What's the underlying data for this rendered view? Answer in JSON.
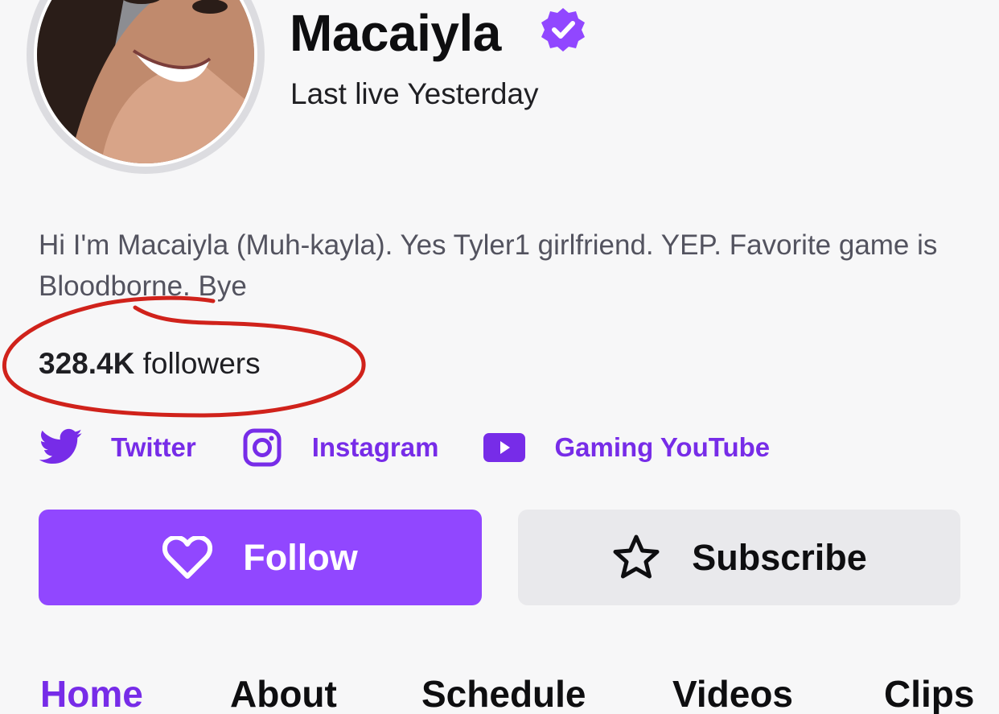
{
  "profile": {
    "display_name": "Macaiyla",
    "last_live": "Last live Yesterday",
    "bio": "Hi I'm Macaiyla (Muh-kayla). Yes Tyler1 girlfriend. YEP. Favorite game is Bloodborne. Bye",
    "followers_count": "328.4K",
    "followers_label": " followers"
  },
  "socials": [
    {
      "label": "Twitter",
      "icon": "twitter-icon"
    },
    {
      "label": "Instagram",
      "icon": "instagram-icon"
    },
    {
      "label": "Gaming YouTube",
      "icon": "youtube-icon"
    }
  ],
  "actions": {
    "follow_label": "Follow",
    "subscribe_label": "Subscribe"
  },
  "tabs": [
    {
      "label": "Home",
      "active": true
    },
    {
      "label": "About",
      "active": false
    },
    {
      "label": "Schedule",
      "active": false
    },
    {
      "label": "Videos",
      "active": false
    },
    {
      "label": "Clips",
      "active": false
    }
  ],
  "colors": {
    "accent": "#9147ff",
    "link": "#772ce8",
    "annotation": "#d0221b",
    "background": "#f7f7f8"
  }
}
